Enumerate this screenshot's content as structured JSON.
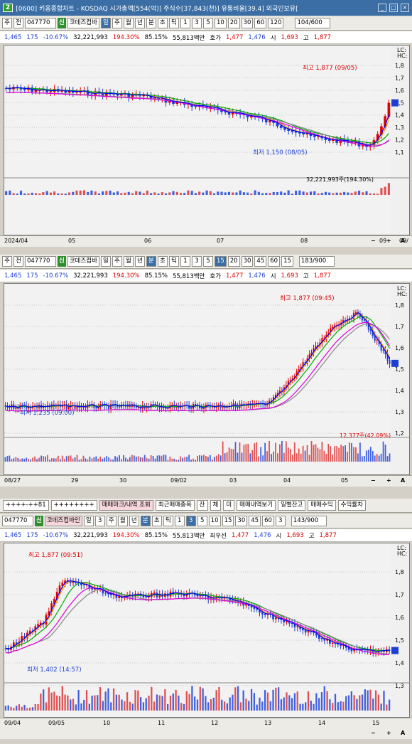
{
  "window": {
    "badge": "2",
    "title": "[0600] 키움종합차트 - KOSDAQ 시가총액[554(억)] 주식수[37,843(천)] 유통비율[39.4] 외국인보유[",
    "buttons": [
      "_",
      "□",
      "×"
    ]
  },
  "common": {
    "price": "1,465",
    "arrow": "▼",
    "change": "175",
    "pct": "-10.67%",
    "volume": "32,221,993",
    "vol_ratio": "194.30%",
    "turnover": "85.15%",
    "amount": "55,813백만",
    "hoga_label": "호가",
    "hoga1": "1,477",
    "hoga2": "1,476",
    "open_l": "시",
    "open": "1,693",
    "high_l": "고",
    "high": "1,877",
    "low_l": "저",
    "low": "1,45"
  },
  "panel1": {
    "toolbar": {
      "sel1": "주",
      "sel2": "전",
      "code": "047770",
      "tag": "신",
      "name": "코데즈컴바",
      "periods": [
        "일",
        "주",
        "월",
        "년",
        "분",
        "초",
        "틱"
      ],
      "active_period": "일",
      "nums": [
        "1",
        "3",
        "5",
        "10",
        "20",
        "30",
        "60",
        "120"
      ],
      "count": "104/600"
    },
    "high_label": "최고 1,877 (09/05)",
    "low_label": "최저 1,150 (08/05)",
    "vol_label": "32,221,993주(194.30%)",
    "lc": "LC:",
    "hc": "HC:",
    "yticks": [
      "1,8",
      "1,7",
      "1,6",
      "1,5",
      "1,4",
      "1,3",
      "1,2",
      "1,1"
    ],
    "xticks": [
      "2024/04",
      "05",
      "06",
      "07",
      "08",
      "09",
      "09/"
    ],
    "price_badge": "1"
  },
  "panel2": {
    "toolbar": {
      "sel1": "주",
      "sel2": "전",
      "code": "047770",
      "tag": "신",
      "name": "코데즈컴바",
      "periods": [
        "일",
        "주",
        "월",
        "년",
        "분",
        "초",
        "틱"
      ],
      "active_period": "분",
      "nums": [
        "1",
        "3",
        "5",
        "15",
        "20",
        "30",
        "45",
        "60"
      ],
      "active_num": "15",
      "interval": "15",
      "count": "183/900"
    },
    "high_label": "최고 1,877 (09:45)",
    "low_label": "최저 1,235 (09:00)",
    "vol_label": "12,377주(42.09%)",
    "lc": "LC:",
    "hc": "HC:",
    "yticks": [
      "1,8",
      "1,7",
      "1,6",
      "1,5",
      "1,4",
      "1,3",
      "1,2"
    ],
    "xticks": [
      "08/27",
      "29",
      "30",
      "09/02",
      "03",
      "04",
      "05"
    ],
    "price_badge": "1"
  },
  "panel3": {
    "toolbar_top": [
      "++++-++81",
      "++++++++",
      "매매마크/내역 조회",
      "최근매매종목",
      "잔",
      "체",
      "미",
      "매매내역보기",
      "일별잔고",
      "매매수익",
      "수익률차"
    ],
    "toolbar": {
      "code": "047770",
      "tag": "신",
      "name": "코데즈컴바인",
      "periods": [
        "일",
        "주",
        "월",
        "년",
        "분",
        "초",
        "틱"
      ],
      "period_num": "3",
      "active_period": "분",
      "nums": [
        "1",
        "3",
        "5",
        "10",
        "15",
        "30",
        "45",
        "60"
      ],
      "active_num": "3",
      "interval": "3",
      "count": "143/900"
    },
    "info_extra": "최우선",
    "high_label": "최고 1,877 (09:51)",
    "low_label": "최저 1,402 (14:57)",
    "lc": "LC:",
    "hc": "HC:",
    "yticks": [
      "1,8",
      "1,7",
      "1,6",
      "1,5",
      "1,4",
      "1,3"
    ],
    "xticks": [
      "09/04",
      "09/05",
      "10",
      "11",
      "12",
      "13",
      "14",
      "15"
    ],
    "price_badge": "1"
  },
  "zoom": {
    "minus": "−",
    "plus": "+",
    "a": "A"
  }
}
